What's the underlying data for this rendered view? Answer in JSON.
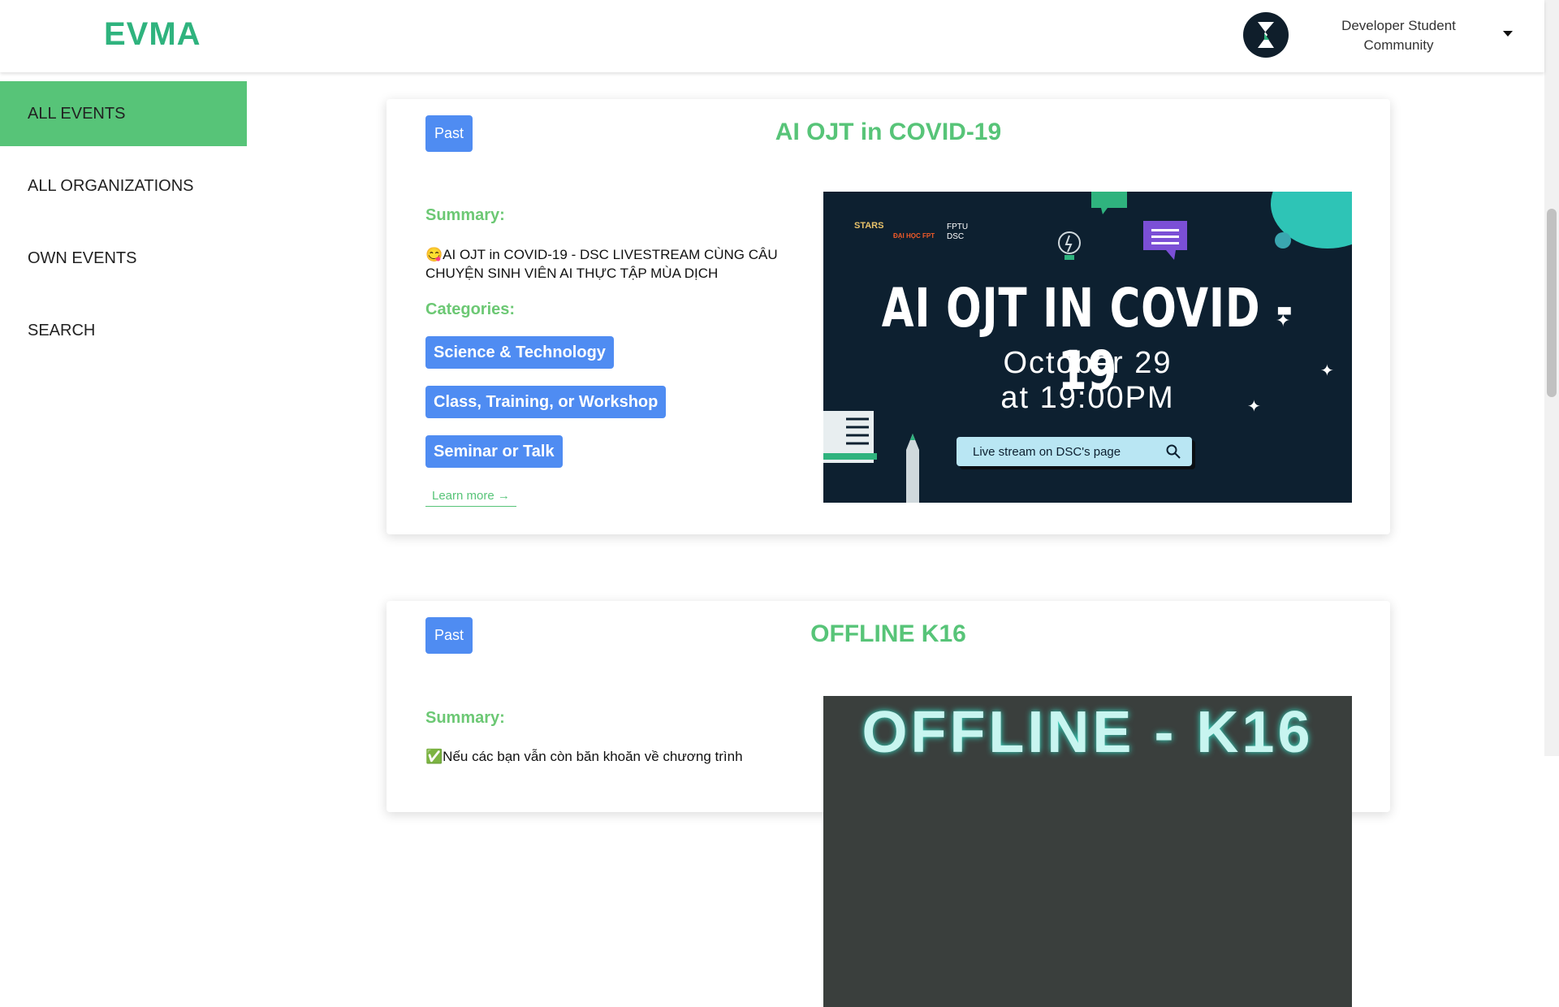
{
  "header": {
    "logo": "EVMA",
    "org_name": "Developer Student Community"
  },
  "sidebar": {
    "items": [
      {
        "label": "ALL EVENTS",
        "active": true
      },
      {
        "label": "ALL ORGANIZATIONS",
        "active": false
      },
      {
        "label": "OWN EVENTS",
        "active": false
      },
      {
        "label": "SEARCH",
        "active": false
      }
    ]
  },
  "events": [
    {
      "status": "Past",
      "title": "AI OJT in COVID-19",
      "summary_label": "Summary:",
      "summary": "😋AI OJT in COVID-19 - DSC LIVESTREAM CÙNG CÂU CHUYỆN SINH VIÊN AI THỰC TẬP MÙA DỊCH",
      "categories_label": "Categories:",
      "categories": [
        "Science & Technology",
        "Class, Training, or Workshop",
        "Seminar or Talk"
      ],
      "learn_more": "Learn more →",
      "poster": {
        "brand_1": "STARS",
        "brand_2": "ĐẠI HỌC FPT",
        "brand_3": "FPTU DSC",
        "title": "AI OJT IN COVID - 19",
        "date_line1": "October 29",
        "date_line2": "at 19:00PM",
        "cta": "Live stream on DSC's page"
      }
    },
    {
      "status": "Past",
      "title": "OFFLINE K16",
      "summary_label": "Summary:",
      "summary": "✅Nếu các bạn vẫn còn băn khoăn về chương trình",
      "poster": {
        "title": "OFFLINE - K16"
      }
    }
  ],
  "colors": {
    "brand_green": "#2fb37e",
    "active_green": "#57c478",
    "tag_blue": "#4f8cf2"
  }
}
